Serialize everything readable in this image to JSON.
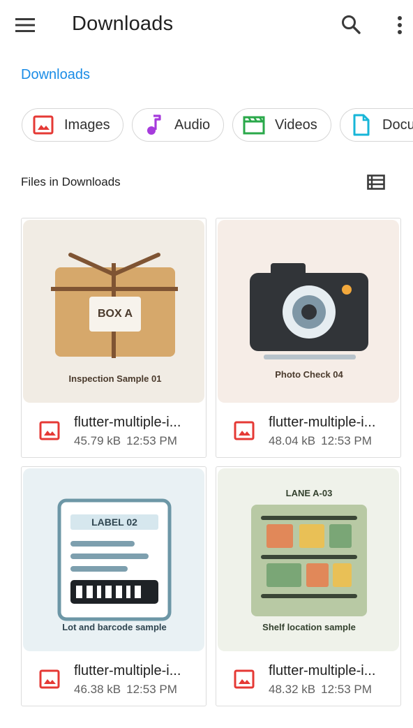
{
  "appbar": {
    "title": "Downloads",
    "menu_icon": "menu-icon",
    "search_icon": "search-icon",
    "more_icon": "more-vert-icon"
  },
  "breadcrumb": {
    "label": "Downloads",
    "color": "#1a8ce6"
  },
  "categories": [
    {
      "label": "Images",
      "icon": "image-icon",
      "color": "#e53935"
    },
    {
      "label": "Audio",
      "icon": "music-note-icon",
      "color": "#a63bdc"
    },
    {
      "label": "Videos",
      "icon": "movie-clapper-icon",
      "color": "#2aa84a"
    },
    {
      "label": "Docu",
      "icon": "document-icon",
      "color": "#17b6d8"
    }
  ],
  "section": {
    "title": "Files in Downloads",
    "view_icon": "list-view-icon"
  },
  "files": [
    {
      "name": "flutter-multiple-i...",
      "size": "45.79 kB",
      "time": "12:53 PM",
      "thumb_caption": "Inspection Sample 01",
      "thumb_label": "BOX A"
    },
    {
      "name": "flutter-multiple-i...",
      "size": "48.04 kB",
      "time": "12:53 PM",
      "thumb_caption": "Photo Check 04"
    },
    {
      "name": "flutter-multiple-i...",
      "size": "46.38 kB",
      "time": "12:53 PM",
      "thumb_caption": "Lot and barcode sample",
      "thumb_label": "LABEL 02"
    },
    {
      "name": "flutter-multiple-i...",
      "size": "48.32 kB",
      "time": "12:53 PM",
      "thumb_caption": "Shelf location sample",
      "thumb_label": "LANE A-03"
    }
  ]
}
